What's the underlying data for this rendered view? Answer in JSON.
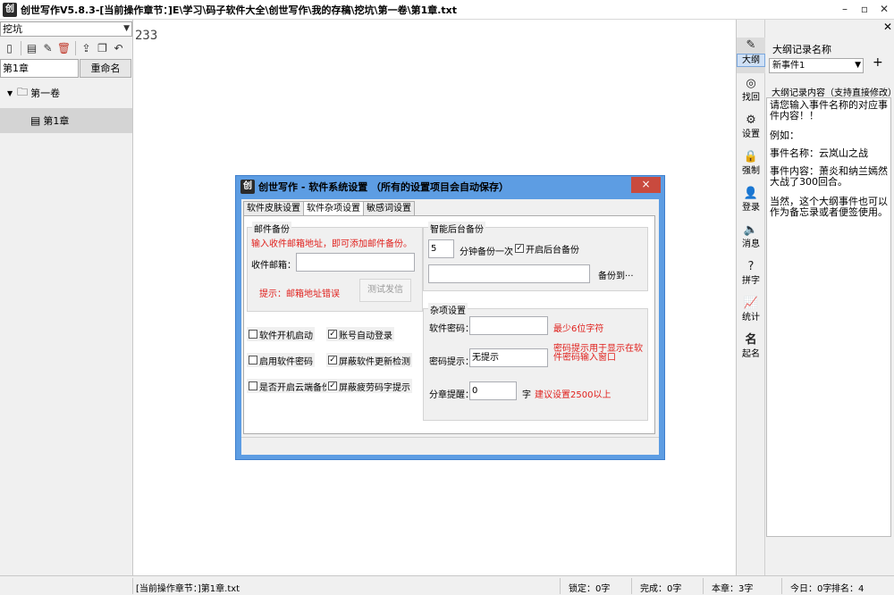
{
  "window": {
    "title": "创世写作V5.8.3-[当前操作章节：]E\\学习\\码子软件大全\\创世写作\\我的存稿\\挖坑\\第一卷\\第1章.txt",
    "app_icon_letter": "创"
  },
  "left_panel": {
    "book_selector": "挖坑",
    "chapter_name_value": "第1章",
    "rename_label": "重命名",
    "tree": {
      "volume": "第一卷",
      "chapter": "第1章"
    }
  },
  "editor": {
    "content": "233"
  },
  "right_tools": [
    {
      "label": "大纲",
      "icon": "edit-icon"
    },
    {
      "label": "找回",
      "icon": "target-icon"
    },
    {
      "label": "设置",
      "icon": "gear-icon"
    },
    {
      "label": "强制",
      "icon": "lock-icon"
    },
    {
      "label": "登录",
      "icon": "user-icon"
    },
    {
      "label": "消息",
      "icon": "speaker-icon"
    },
    {
      "label": "拼字",
      "icon": "question-icon"
    },
    {
      "label": "统计",
      "icon": "chart-icon"
    },
    {
      "label": "起名",
      "icon": "name-icon",
      "glyph": "名"
    }
  ],
  "outline_panel": {
    "name_label": "大纲记录名称",
    "selected_event": "新事件1",
    "add_label": "+",
    "content_label": "大纲记录内容（支持直接修改）",
    "content_lines": [
      "请您输入事件名称的对应事件内容！！",
      "例如：",
      "事件名称：云岚山之战",
      "事件内容：萧炎和纳兰嫣然大战了300回合。",
      "当然，这个大纲事件也可以作为备忘录或者便签使用。"
    ]
  },
  "status_bar": {
    "current_chapter": "[当前操作章节：]第1章.txt",
    "locked": "锁定：0字",
    "done": "完成：0字",
    "this_chapter": "本章：3字",
    "today": "今日：0字",
    "rank": "排名：4"
  },
  "dialog": {
    "title": "创世写作 - 软件系统设置 （所有的设置项目会自动保存）",
    "close_label": "×",
    "tabs": [
      "软件皮肤设置",
      "软件杂项设置",
      "敏感词设置"
    ],
    "active_tab": 1,
    "email_group": {
      "title": "邮件备份",
      "hint": "输入收件邮箱地址，即可添加邮件备份。",
      "email_label": "收件邮箱：",
      "email_value": "",
      "tip": "提示：邮箱地址错误",
      "test_button": "测试发信"
    },
    "checkboxes": [
      {
        "label": "软件开机启动",
        "checked": false
      },
      {
        "label": "账号自动登录",
        "checked": true
      },
      {
        "label": "启用软件密码",
        "checked": false
      },
      {
        "label": "屏蔽软件更新检测",
        "checked": true
      },
      {
        "label": "是否开启云端备份",
        "checked": false
      },
      {
        "label": "屏蔽疲劳码字提示",
        "checked": true
      }
    ],
    "backup_group": {
      "title": "智能后台备份",
      "minutes_value": "5",
      "minutes_suffix": "分钟备份一次",
      "enable_label": "开启后台备份",
      "enable_checked": true,
      "path_value": "",
      "backup_to_button": "备份到···"
    },
    "misc_group": {
      "title": "杂项设置",
      "password_label": "软件密码：",
      "password_value": "",
      "password_hint": "最少6位字符",
      "hint_label": "密码提示：",
      "hint_value": "无提示",
      "hint_note": "密码提示用于显示在软件密码输入窗口",
      "split_label": "分章提醒：",
      "split_value": "0",
      "split_unit": "字",
      "split_note": "建议设置2500以上"
    }
  }
}
